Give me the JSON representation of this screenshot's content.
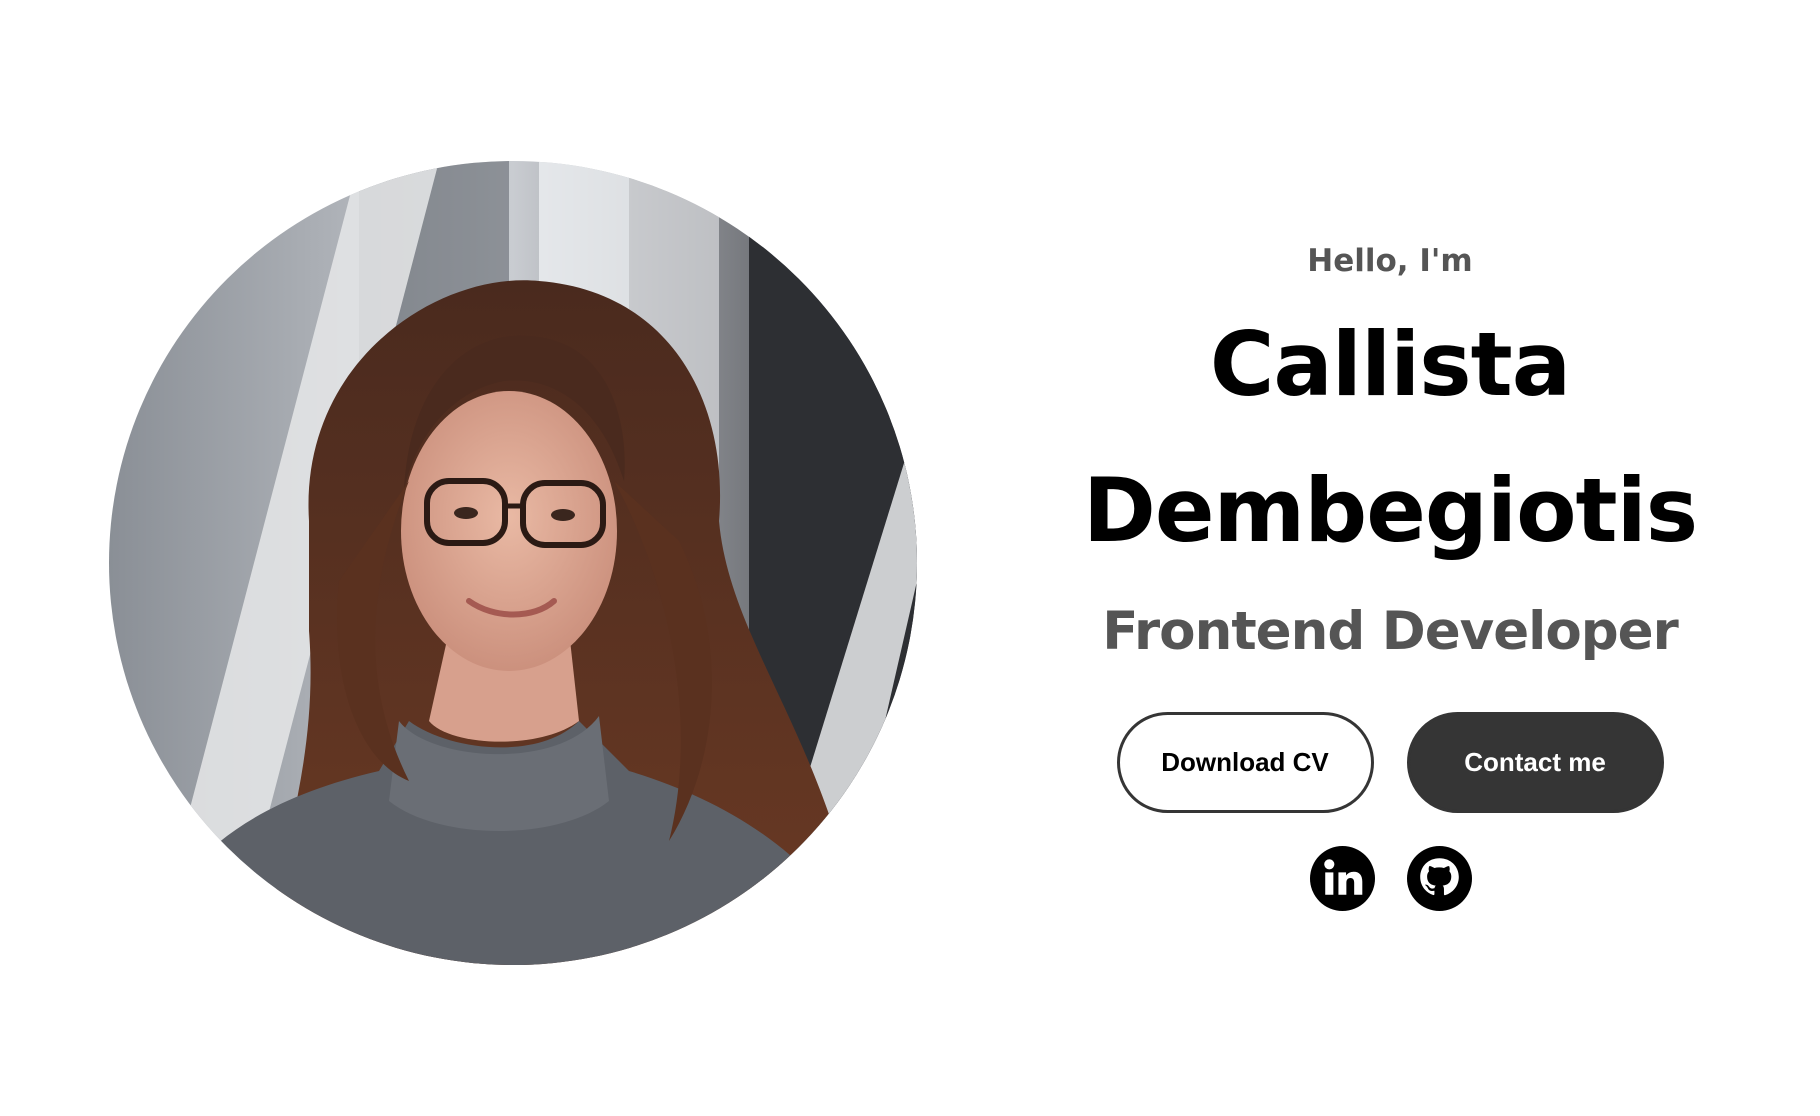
{
  "hero": {
    "greeting": "Hello, I'm",
    "first_name": "Callista",
    "last_name": "Dembegiotis",
    "role": "Frontend Developer",
    "photo_alt": "Callista Dembegiotis profile picture"
  },
  "actions": {
    "download_cv_label": "Download CV",
    "contact_label": "Contact me"
  },
  "socials": [
    {
      "name": "LinkedIn",
      "icon": "linkedin-icon"
    },
    {
      "name": "GitHub",
      "icon": "github-icon"
    }
  ],
  "colors": {
    "text": "#000000",
    "muted": "#555555",
    "button_dark": "#353535",
    "background": "#ffffff"
  }
}
